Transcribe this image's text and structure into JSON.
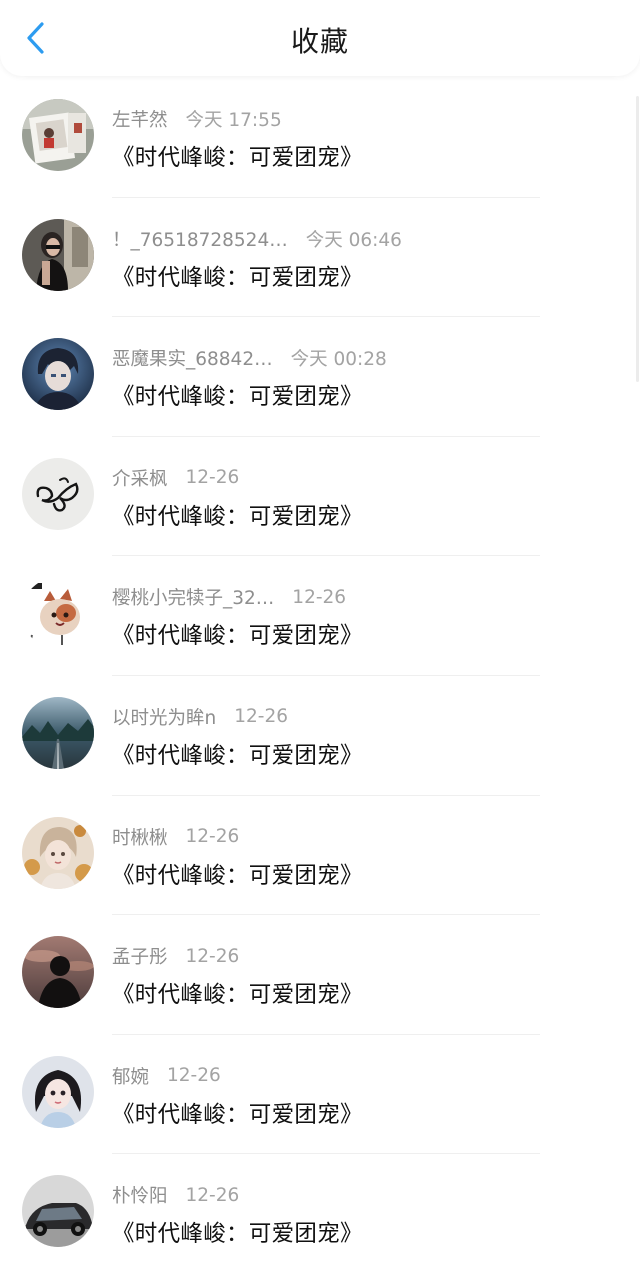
{
  "header": {
    "title": "收藏",
    "back_icon": "chevron-left-icon",
    "accent_color": "#2d9cf0"
  },
  "items": [
    {
      "user": "左芊然",
      "time": "今天 17:55",
      "subject": "《时代峰峻：可爱团宠》"
    },
    {
      "user": "！_76518728524…",
      "time": "今天 06:46",
      "subject": "《时代峰峻：可爱团宠》"
    },
    {
      "user": "恶魔果实_68842…",
      "time": "今天 00:28",
      "subject": "《时代峰峻：可爱团宠》"
    },
    {
      "user": "介采枫",
      "time": "12-26",
      "subject": "《时代峰峻：可爱团宠》"
    },
    {
      "user": "樱桃小完犊子_32…",
      "time": "12-26",
      "subject": "《时代峰峻：可爱团宠》"
    },
    {
      "user": "以时光为眸n",
      "time": "12-26",
      "subject": "《时代峰峻：可爱团宠》"
    },
    {
      "user": "时楸楸",
      "time": "12-26",
      "subject": "《时代峰峻：可爱团宠》"
    },
    {
      "user": "孟子彤",
      "time": "12-26",
      "subject": "《时代峰峻：可爱团宠》"
    },
    {
      "user": "郁婉",
      "time": "12-26",
      "subject": "《时代峰峻：可爱团宠》"
    },
    {
      "user": "朴怜阳",
      "time": "12-26",
      "subject": "《时代峰峻：可爱团宠》"
    }
  ]
}
